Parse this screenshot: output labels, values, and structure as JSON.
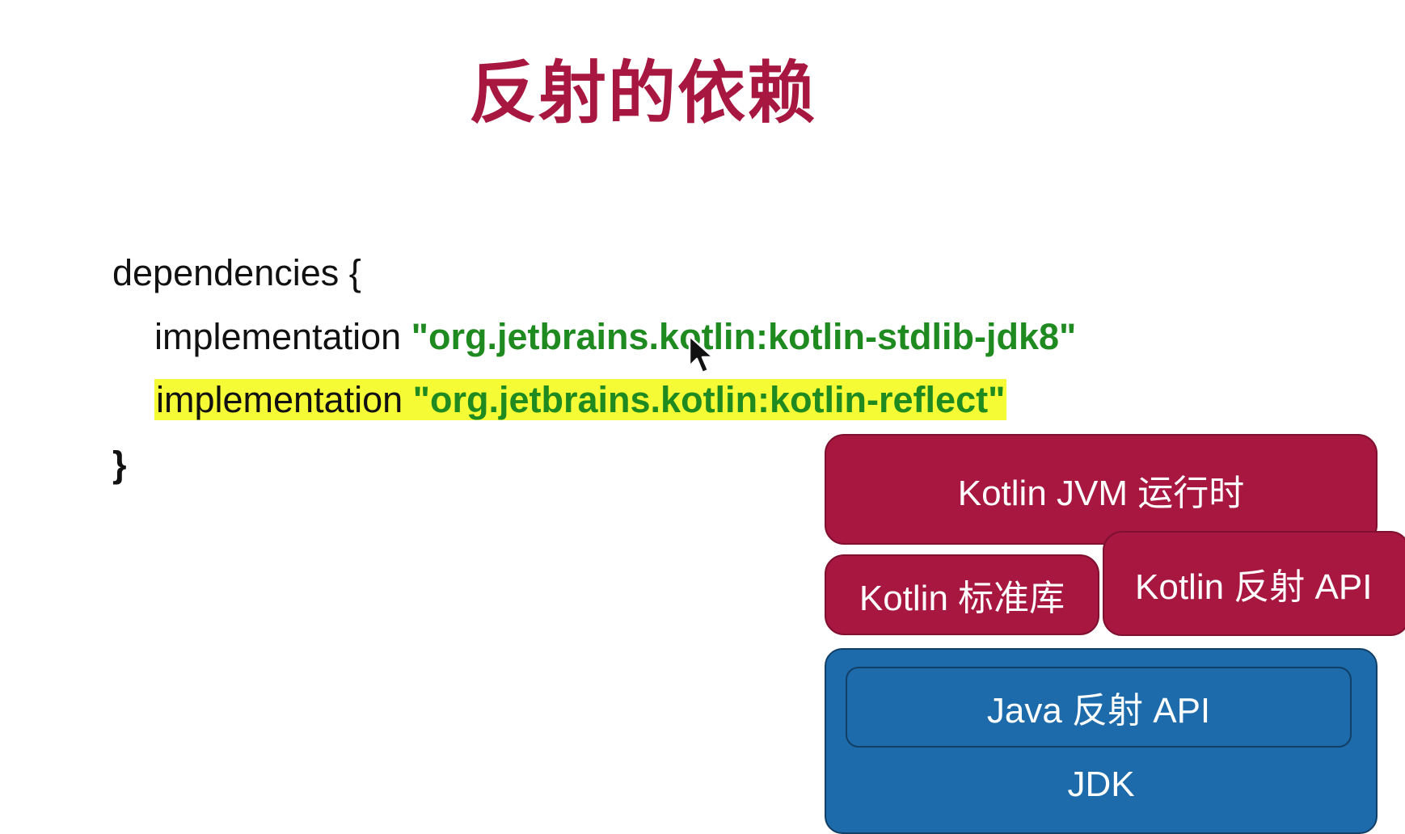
{
  "title": "反射的依赖",
  "code": {
    "open": "dependencies {",
    "lines": [
      {
        "keyword": "implementation",
        "value": "\"org.jetbrains.kotlin:kotlin-stdlib-jdk8\""
      },
      {
        "keyword": "implementation",
        "value": "\"org.jetbrains.kotlin:kotlin-reflect\""
      }
    ],
    "close": "}"
  },
  "diagram": {
    "kotlin_jvm": "Kotlin JVM 运行时",
    "kotlin_stdlib": "Kotlin 标准库",
    "kotlin_reflect": "Kotlin 反射 API",
    "java_reflect": "Java 反射 API",
    "jdk": "JDK"
  },
  "colors": {
    "title": "#a8173f",
    "string": "#1f8a1f",
    "highlight": "#f5fb35",
    "kotlin_box": "#a8173f",
    "jdk_box": "#1d6bab"
  },
  "icons": [
    "mouse-pointer-icon"
  ]
}
